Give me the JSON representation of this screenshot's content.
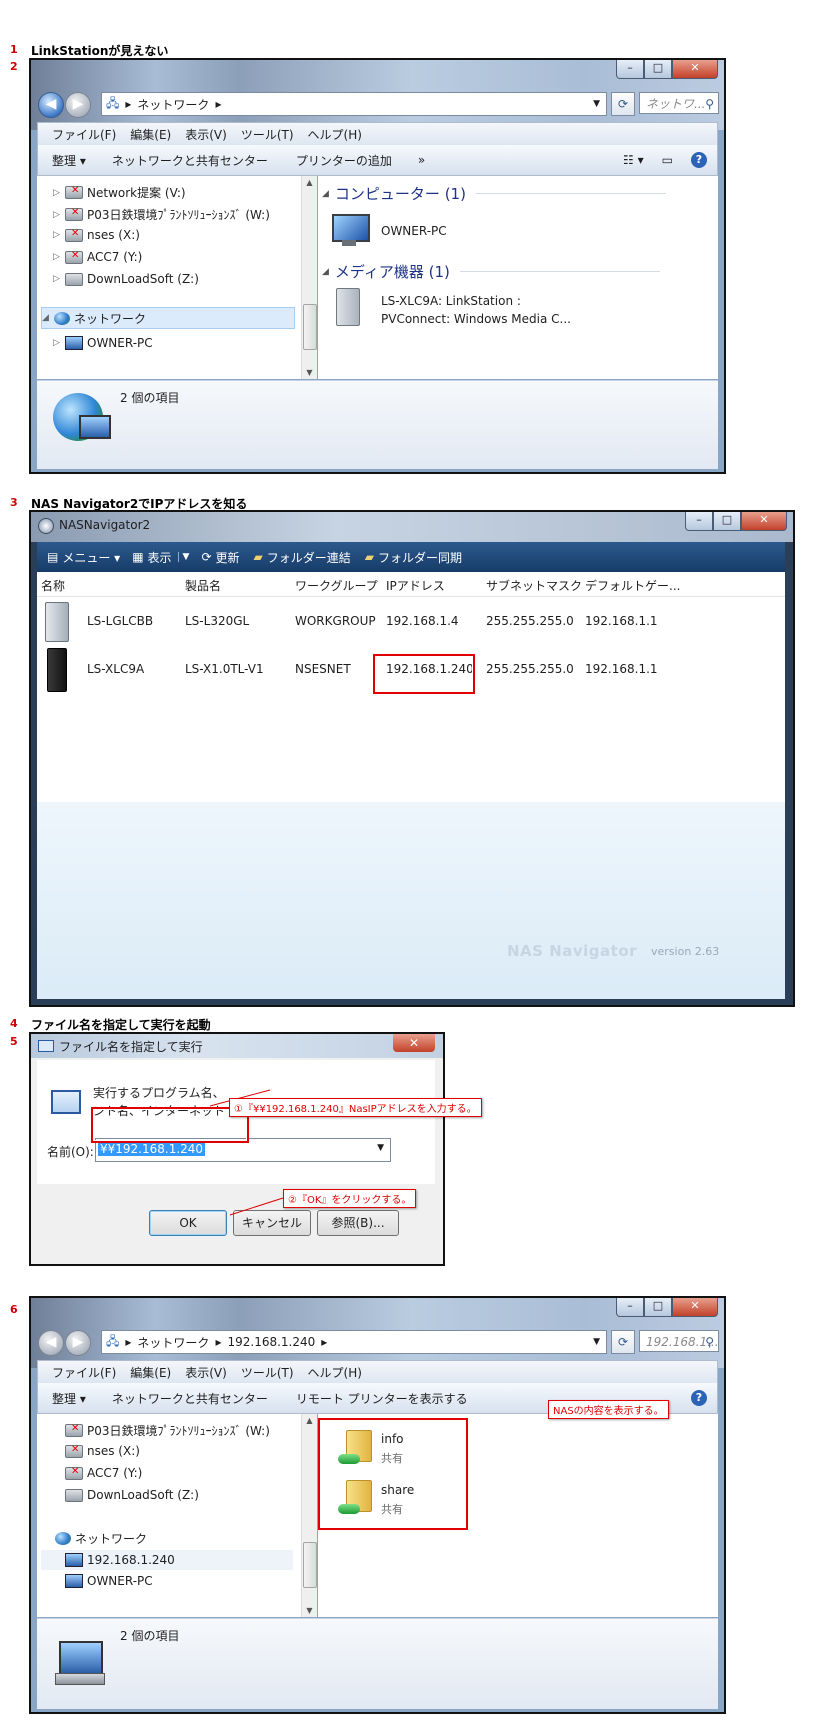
{
  "steps": [
    {
      "num": "1",
      "title": "LinkStationが見えない"
    },
    {
      "num": "2"
    },
    {
      "num": "3",
      "title": "NAS Navigator2でIPアドレスを知る"
    },
    {
      "num": "4",
      "title": "ファイル名を指定して実行を起動"
    },
    {
      "num": "5"
    },
    {
      "num": "6"
    }
  ],
  "explorer1": {
    "address": [
      "ネットワーク"
    ],
    "search_placeholder": "ネットワ...",
    "menu": [
      "ファイル(F)",
      "編集(E)",
      "表示(V)",
      "ツール(T)",
      "ヘルプ(H)"
    ],
    "commands": [
      "整理 ▾",
      "ネットワークと共有センター",
      "プリンターの追加",
      "»"
    ],
    "tree": [
      {
        "label": "Network提案 (V:)",
        "icon": "drive-disconnected-icon"
      },
      {
        "label": "P03日鉄環境ﾌﾟﾗﾝﾄｿﾘｭｰｼｮﾝｽﾞ (W:)",
        "icon": "drive-disconnected-icon"
      },
      {
        "label": "nses (X:)",
        "icon": "drive-disconnected-icon"
      },
      {
        "label": "ACC7  (Y:)",
        "icon": "drive-disconnected-icon"
      },
      {
        "label": "DownLoadSoft (Z:)",
        "icon": "drive-icon"
      },
      {
        "label": "ネットワーク",
        "icon": "network-icon"
      },
      {
        "label": "OWNER-PC",
        "icon": "computer-icon"
      }
    ],
    "groups": [
      {
        "header": "コンピューター (1)",
        "items": [
          {
            "label": "OWNER-PC"
          }
        ]
      },
      {
        "header": "メディア機器 (1)",
        "items": [
          {
            "label1": "LS-XLC9A: LinkStation :",
            "label2": "PVConnect: Windows Media C..."
          }
        ]
      }
    ],
    "status": "2 個の項目"
  },
  "nasnav": {
    "title": "NASNavigator2",
    "toolbar": [
      "メニュー ▾",
      "表示",
      "更新",
      "フォルダー連結",
      "フォルダー同期"
    ],
    "columns": [
      "名称",
      "製品名",
      "ワークグループ",
      "IPアドレス",
      "サブネットマスク",
      "デフォルトゲー..."
    ],
    "rows": [
      [
        "LS-LGLCBB",
        "LS-L320GL",
        "WORKGROUP",
        "192.168.1.4",
        "255.255.255.0",
        "192.168.1.1"
      ],
      [
        "LS-XLC9A",
        "LS-X1.0TL-V1",
        "NSESNET",
        "192.168.1.240",
        "255.255.255.0",
        "192.168.1.1"
      ]
    ],
    "brand": "NAS Navigator",
    "version": "version 2.63"
  },
  "rundialog": {
    "title": "ファイル名を指定して実行",
    "desc_line1": "実行するプログラム名、",
    "desc_line2": "ント名、インターネット",
    "label": "名前(O):",
    "value": "¥¥192.168.1.240",
    "ok": "OK",
    "cancel": "キャンセル",
    "browse": "参照(B)...",
    "callout1": "①『¥¥192.168.1.240』NasIPアドレスを入力する。",
    "callout2": "②『OK』をクリックする。"
  },
  "explorer2": {
    "address": [
      "ネットワーク",
      "192.168.1.240"
    ],
    "search_placeholder": "192.168.1...",
    "menu": [
      "ファイル(F)",
      "編集(E)",
      "表示(V)",
      "ツール(T)",
      "ヘルプ(H)"
    ],
    "commands": [
      "整理 ▾",
      "ネットワークと共有センター",
      "リモート プリンターを表示する"
    ],
    "tree": [
      {
        "label": "P03日鉄環境ﾌﾟﾗﾝﾄｿﾘｭｰｼｮﾝｽﾞ (W:)"
      },
      {
        "label": "nses (X:)"
      },
      {
        "label": "ACC7  (Y:)"
      },
      {
        "label": "DownLoadSoft (Z:)"
      },
      {
        "label": "ネットワーク"
      },
      {
        "label": "192.168.1.240"
      },
      {
        "label": "OWNER-PC"
      }
    ],
    "folders": [
      {
        "name": "info",
        "sub": "共有"
      },
      {
        "name": "share",
        "sub": "共有"
      }
    ],
    "callout": "NASの内容を表示する。",
    "status": "2 個の項目"
  }
}
